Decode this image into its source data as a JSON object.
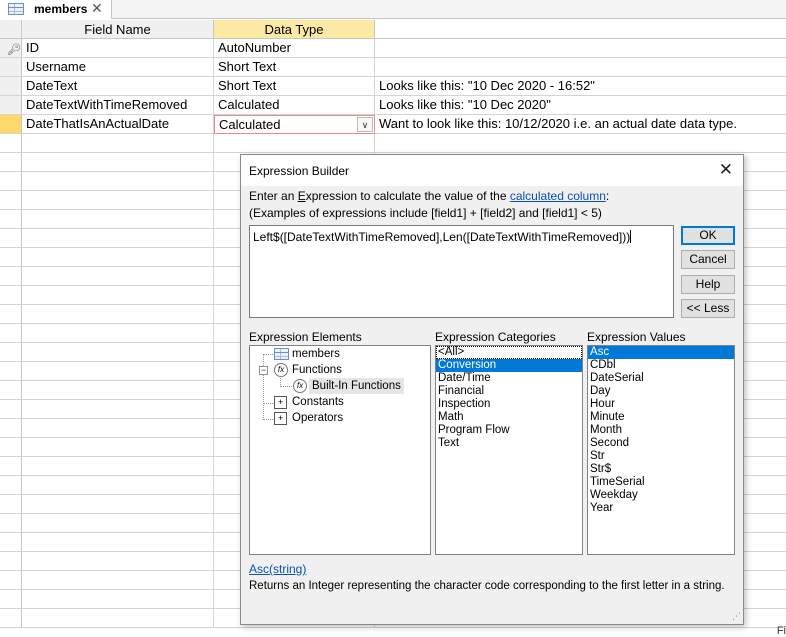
{
  "tab": {
    "label": "members"
  },
  "grid": {
    "headers": {
      "field_name": "Field Name",
      "data_type": "Data Type"
    },
    "rows": [
      {
        "field": "ID",
        "type": "AutoNumber",
        "desc": ""
      },
      {
        "field": "Username",
        "type": "Short Text",
        "desc": ""
      },
      {
        "field": "DateText",
        "type": "Short Text",
        "desc": "Looks like this: \"10 Dec 2020 - 16:52\""
      },
      {
        "field": "DateTextWithTimeRemoved",
        "type": "Calculated",
        "desc": "Looks like this: \"10 Dec 2020\""
      },
      {
        "field": "DateThatIsAnActualDate",
        "type": "Calculated",
        "desc": "Want to look like this: 10/12/2020 i.e. an actual date data type."
      }
    ],
    "corner_text": "Fi"
  },
  "dialog": {
    "title": "Expression Builder",
    "instr1_prefix": "Enter an ",
    "instr1_e": "E",
    "instr1_mid": "xpression to calculate the value of the ",
    "instr1_link": "calculated column",
    "instr1_suffix": ":",
    "instr2": "(Examples of expressions include [field1] + [field2] and [field1] < 5)",
    "expression": "Left$([DateTextWithTimeRemoved],Len([DateTextWithTimeRemoved]))",
    "buttons": {
      "ok": "OK",
      "cancel": "Cancel",
      "help": "Help",
      "less": "<< Less"
    },
    "elements_label": "Expression Elements",
    "categories_label": "Expression Categories",
    "values_label": "Expression Values",
    "elements": {
      "members": "members",
      "functions": "Functions",
      "builtin": "Built-In Functions",
      "constants": "Constants",
      "operators": "Operators"
    },
    "categories": [
      "<All>",
      "Conversion",
      "Date/Time",
      "Financial",
      "Inspection",
      "Math",
      "Program Flow",
      "Text"
    ],
    "selected_category": "Conversion",
    "values": [
      "Asc",
      "CDbl",
      "DateSerial",
      "Day",
      "Hour",
      "Minute",
      "Month",
      "Second",
      "Str",
      "Str$",
      "TimeSerial",
      "Weekday",
      "Year"
    ],
    "selected_value": "Asc",
    "help_link": "Asc(string)",
    "help_desc": "Returns an Integer representing the character code corresponding to the first letter in a string."
  },
  "colors": {
    "accent": "#0078d7",
    "header_highlight": "#fce9a4",
    "current_row": "#fdd86a",
    "link": "#0a50b5"
  }
}
